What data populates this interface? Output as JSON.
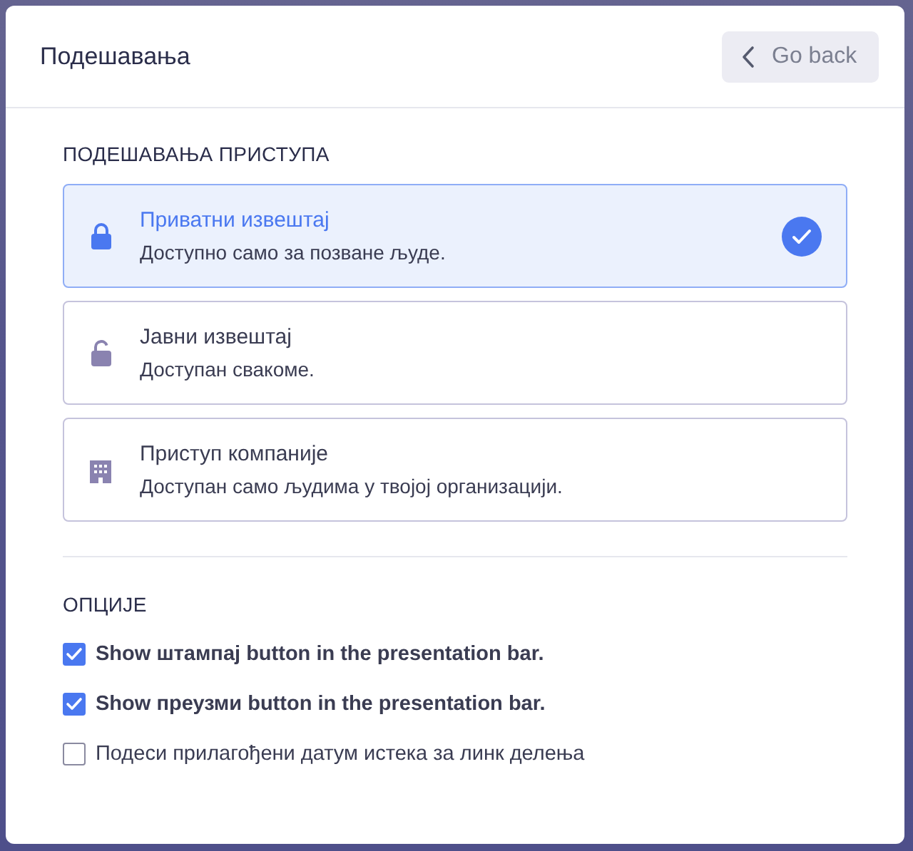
{
  "dialog": {
    "title": "Подешавања",
    "back_button": {
      "label": "Go back"
    }
  },
  "access": {
    "heading": "ПОДЕШАВАЊА ПРИСТУПА",
    "options": [
      {
        "kind": "lock",
        "title": "Приватни извештај",
        "description": "Доступно само за позване људе.",
        "selected": true
      },
      {
        "kind": "unlock",
        "title": "Јавни извештај",
        "description": "Доступан свакоме.",
        "selected": false
      },
      {
        "kind": "building",
        "title": "Приступ компаније",
        "description": "Доступан само људима у твојој организацији.",
        "selected": false
      }
    ]
  },
  "options": {
    "heading": "ОПЦИЈЕ",
    "items": [
      {
        "kind": "strong",
        "label": "Show **штампај** button in the presentation bar.",
        "checked": true
      },
      {
        "kind": "strong",
        "label": "Show **преузми** button in the presentation bar.",
        "checked": true
      },
      {
        "kind": "plain",
        "label": "Подеси прилагођени датум истека за линк делења",
        "checked": false
      }
    ]
  }
}
